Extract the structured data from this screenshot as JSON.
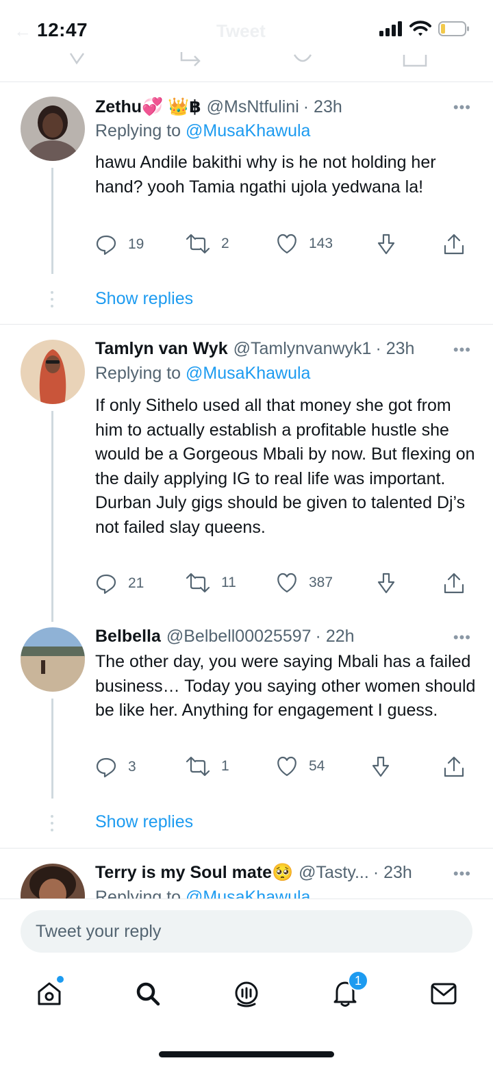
{
  "status_bar": {
    "time": "12:47",
    "faded_title": "Tweet"
  },
  "tweets": [
    {
      "name": "Zethu💞 👑฿",
      "handle": "@MsNtfulini",
      "time": "· 23h",
      "replying_prefix": "Replying to",
      "replying_to": "@MusaKhawula",
      "text": "hawu Andile bakithi why is he not holding her hand? yooh Tamia ngathi ujola yedwana la!",
      "replies": "19",
      "retweets": "2",
      "likes": "143",
      "show_replies": "Show replies",
      "avatar_colors": [
        "#6b5a57",
        "#2b1d1a"
      ]
    },
    {
      "name": "Tamlyn van Wyk",
      "handle": "@Tamlynvanwyk1",
      "time": "· 23h",
      "replying_prefix": "Replying to",
      "replying_to": "@MusaKhawula",
      "text": "If only Sithelo used all that money she got from him to actually establish a profitable hustle she would be a Gorgeous Mbali by now. But flexing on the daily applying IG to real life was important. Durban July gigs should be given to talented Dj’s not failed slay queens.",
      "replies": "21",
      "retweets": "11",
      "likes": "387",
      "avatar_colors": [
        "#c9553a",
        "#e9d3b8"
      ]
    },
    {
      "name": "Belbella",
      "handle": "@Belbell00025597",
      "time": "· 22h",
      "text": "The other day, you were saying Mbali has a failed business… Today you saying other women should be like her. Anything for engagement I guess.",
      "replies": "3",
      "retweets": "1",
      "likes": "54",
      "show_replies": "Show replies",
      "avatar_colors": [
        "#8fb2d6",
        "#c9b59a"
      ]
    },
    {
      "name": "Terry is my Soul mate🥺",
      "handle": "@Tasty...",
      "time": "· 23h",
      "replying_prefix": "Replying to",
      "replying_to": "@MusaKhawula",
      "avatar_colors": [
        "#6a4a3a",
        "#2a1c16"
      ]
    }
  ],
  "composer": {
    "placeholder": "Tweet your reply"
  },
  "tab_bar": {
    "tabs": [
      "home-icon",
      "search-icon",
      "spaces-icon",
      "notifications-icon",
      "messages-icon"
    ],
    "notification_count": "1",
    "accent": "#1d9bf0"
  }
}
